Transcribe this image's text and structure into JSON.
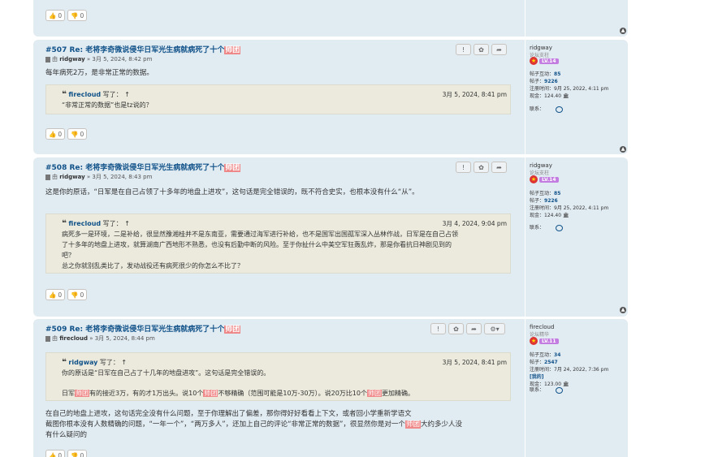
{
  "top_votes": {
    "up": "0",
    "down": "0"
  },
  "posts": [
    {
      "title_prefix": "#507 Re: 老将李奇微说侵华日军光生病就病死了十个",
      "title_hl": "师团",
      "author": "ridgway",
      "meta_rest": " » 3月 5, 2024, 8:42 pm",
      "content": "每年病死2万，是非常正常的数据。",
      "quote": {
        "author": "firecloud",
        "wrote": " 写了：",
        "up_arrow": "↑",
        "time": "3月 5, 2024, 8:41 pm",
        "lines": [
          "“非常正常的数据”也是tz说的？"
        ]
      },
      "votes": {
        "up": "0",
        "down": "0"
      },
      "profile": {
        "name": "ridgway",
        "rank": "论坛支柱",
        "level": "LV.14",
        "stats": [
          {
            "label": "帖子互动：",
            "value": "85"
          },
          {
            "label": "帖子：",
            "value": "9226"
          },
          {
            "label": "注册时间：",
            "value": "9月 25, 2022, 4:11 pm"
          },
          {
            "label": "现金：",
            "value": "124.40"
          }
        ],
        "contact": "联系："
      }
    },
    {
      "title_prefix": "#508 Re: 老将李奇微说侵华日军光生病就病死了十个",
      "title_hl": "师团",
      "author": "ridgway",
      "meta_rest": " » 3月 5, 2024, 8:43 pm",
      "content": "这是你的原话，“日军是在自己占领了十多年的地盘上进攻”，这句话是完全错误的，既不符合史实，也根本没有什么“从”。",
      "quote": {
        "author": "firecloud",
        "wrote": " 写了：",
        "up_arrow": "↑",
        "time": "3月 4, 2024, 9:04 pm",
        "lines": [
          "病死多一是环境，二是补给，很显然豫湘桂并不是东南亚，需要通过海军进行补给，也不是国军出国孤军深入丛林作战，日军是在自己占领",
          "了十多年的地盘上进攻，就算湖南广西地形不熟悉，也没有后勤中断的风险。至于你扯什么中美空军狂轰乱炸，那是你看抗日神剧见到的",
          "吧？",
          "总之你就别乱类比了，发动战役还有病死很少的你怎么不比了？"
        ]
      },
      "votes": {
        "up": "0",
        "down": "0"
      },
      "profile": {
        "name": "ridgway",
        "rank": "论坛支柱",
        "level": "LV.14",
        "stats": [
          {
            "label": "帖子互动：",
            "value": "85"
          },
          {
            "label": "帖子：",
            "value": "9226"
          },
          {
            "label": "注册时间：",
            "value": "9月 25, 2022, 4:11 pm"
          },
          {
            "label": "现金：",
            "value": "124.40"
          }
        ],
        "contact": "联系："
      }
    },
    {
      "title_prefix": "#509 Re: 老将李奇微说侵华日军光生病就病死了十个",
      "title_hl": "师团",
      "author": "firecloud",
      "meta_rest": " » 3月 5, 2024, 8:44 pm",
      "quote": {
        "author": "ridgway",
        "wrote": " 写了：",
        "up_arrow": "↑",
        "time": "3月 5, 2024, 8:41 pm",
        "line1": "你的原话是“日军在自己占了十几年的地盘进攻”。这句话是完全错误的。",
        "line2_a": "日军",
        "line2_hl1": "师团",
        "line2_b": "有的接近3万，有的才1万出头。说10个",
        "line2_hl2": "师团",
        "line2_c": "不够精确（范围可能是10万-30万）。说20万比10个",
        "line2_hl3": "师团",
        "line2_d": "更加精确。"
      },
      "body1": "在自己的地盘上进攻，这句话完全没有什么问题，至于你理解出了偏差，那你得好好看看上下文，或者回小学重新学语文",
      "body2_a": "截图你根本没有人数精确的问题，“一年一个”，“两万多人”，还加上自己的评论“非常正常的数据”，很显然你是对一个",
      "body2_hl": "师团",
      "body2_b": "大约多少人没",
      "body3": "有什么疑问的",
      "votes": {
        "up": "0",
        "down": "0"
      },
      "profile": {
        "name": "firecloud",
        "rank": "论坛精华",
        "level": "LV.11",
        "stats": [
          {
            "label": "帖子互动：",
            "value": "34"
          },
          {
            "label": "帖子：",
            "value": "2547"
          },
          {
            "label": "注册时间：",
            "value": "7月 24, 2022, 7:36 pm"
          },
          {
            "label": "",
            "value": "[我的]"
          },
          {
            "label": "现金：",
            "value": "123.00"
          }
        ],
        "contact": "联系："
      }
    }
  ]
}
